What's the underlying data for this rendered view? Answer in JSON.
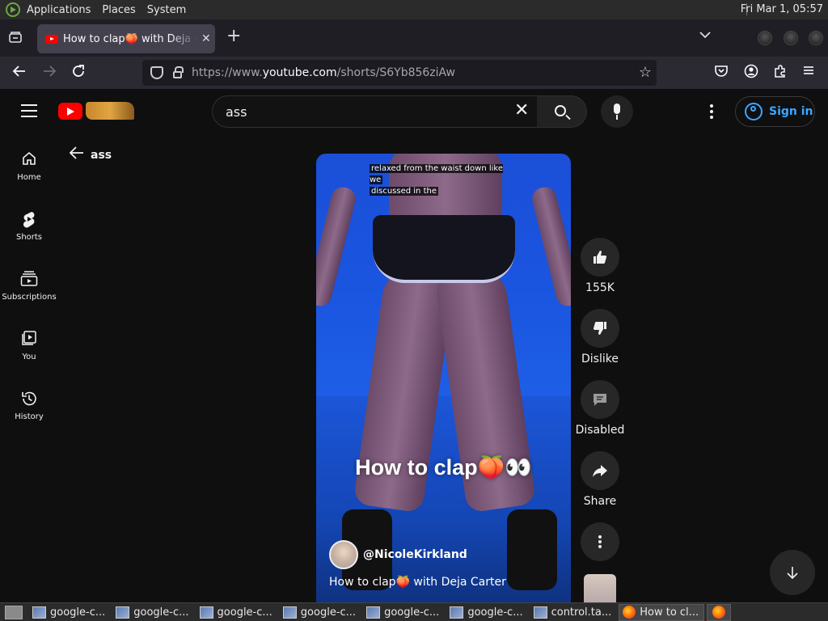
{
  "top_panel": {
    "menus": [
      "Applications",
      "Places",
      "System"
    ],
    "clock": "Fri Mar  1, 05:57"
  },
  "browser": {
    "tab_title": "How to clap🍑 with Deja Carter",
    "url_prefix": "https://www.",
    "url_host": "youtube.com",
    "url_path": "/shorts/S6Yb856ziAw"
  },
  "youtube": {
    "search_query": "ass",
    "sign_in_label": "Sign in",
    "back_label": "ass",
    "guide": [
      {
        "label": "Home"
      },
      {
        "label": "Shorts"
      },
      {
        "label": "Subscriptions"
      },
      {
        "label": "You"
      },
      {
        "label": "History"
      }
    ],
    "short": {
      "caption_line1": "relaxed from the waist down like we",
      "caption_line2": "discussed in the",
      "overlay_title": "How to clap🍑👀",
      "channel": "@NicoleKirkland",
      "description": "How to clap🍑 with Deja Carter"
    },
    "actions": {
      "like_count": "155K",
      "dislike_label": "Dislike",
      "comments_label": "Disabled",
      "share_label": "Share"
    }
  },
  "taskbar": {
    "tasks": [
      "google-c...",
      "google-c...",
      "google-c...",
      "google-c...",
      "google-c...",
      "google-c...",
      "control.ta...",
      "How to cl..."
    ]
  }
}
